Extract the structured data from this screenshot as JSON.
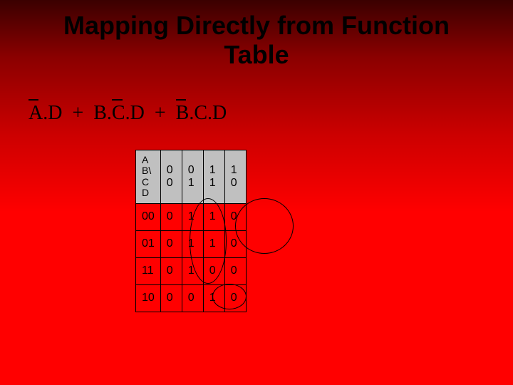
{
  "title": "Mapping Directly from Function Table",
  "expression": {
    "terms": [
      "A",
      ".",
      "D",
      "+",
      "B",
      ".",
      "C",
      ".",
      "D",
      "+",
      "B",
      ".",
      "C",
      ".",
      "D"
    ],
    "display_plain": "A.D + B.C.D + B.C.D",
    "overbars": [
      "A",
      "C(second term)",
      "B(third term)"
    ]
  },
  "kmap": {
    "corner_label": "A B\\ C D",
    "col_headers": [
      "0 0",
      "0 1",
      "1 1",
      "1 0"
    ],
    "rows": [
      {
        "label": "00",
        "cells": [
          "0",
          "1",
          "1",
          "0"
        ]
      },
      {
        "label": "01",
        "cells": [
          "0",
          "1",
          "1",
          "0"
        ]
      },
      {
        "label": "11",
        "cells": [
          "0",
          "1",
          "0",
          "0"
        ]
      },
      {
        "label": "10",
        "cells": [
          "0",
          "0",
          "1",
          "0"
        ]
      }
    ]
  },
  "groupings": [
    {
      "desc": "oval around cells (rows 00,01 cols 01,11)"
    },
    {
      "desc": "oval around cells (rows 00,01,11 col 01 area)"
    },
    {
      "desc": "oval around cell row 10 col 11"
    }
  ]
}
